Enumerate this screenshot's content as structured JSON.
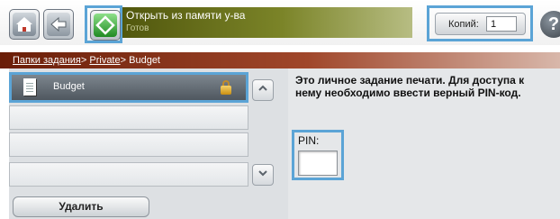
{
  "header": {
    "status_title": "Открыть из памяти у-ва",
    "status_sub": "Готов",
    "copies_label": "Копий:",
    "copies_value": "1",
    "help_glyph": "?"
  },
  "breadcrumb": {
    "items": [
      "Папки задания",
      "Private",
      "Budget"
    ],
    "separator": ">"
  },
  "job_list": {
    "items": [
      {
        "name": "Budget",
        "selected": true,
        "locked": true
      },
      {
        "name": "",
        "selected": false
      },
      {
        "name": "",
        "selected": false
      },
      {
        "name": "",
        "selected": false
      }
    ]
  },
  "actions": {
    "delete_label": "Удалить"
  },
  "info": {
    "message": "Это личное задание печати. Для доступа к нему необходимо ввести верный PIN-код.",
    "pin_label": "PIN:",
    "pin_value": ""
  },
  "icons": {
    "home": "home-icon",
    "back": "back-icon",
    "start": "start-icon",
    "help": "help-icon",
    "document": "document-icon",
    "lock": "lock-icon",
    "scroll_up": "chevron-up-icon",
    "scroll_down": "chevron-down-icon"
  },
  "colors": {
    "highlight": "#5ba4d6",
    "breadcrumb_bg": "#8a2f12",
    "status_bg": "#6b7320",
    "start_green": "#2fa12f"
  }
}
